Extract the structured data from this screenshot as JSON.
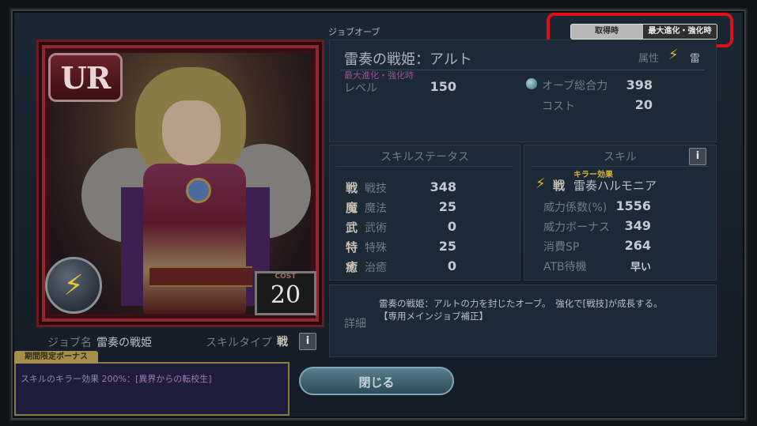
{
  "header": {
    "title": "ジョブオーブ"
  },
  "view_toggle": {
    "option_obtained": "取得時",
    "option_max": "最大進化・強化時",
    "selected": "最大進化・強化時"
  },
  "card": {
    "rarity": "UR",
    "element_icon": "lightning-icon",
    "cost_label": "COST",
    "cost_value": "20",
    "job_label": "ジョブ名",
    "job_name": "雷奏の戦姫",
    "skill_type_label": "スキルタイプ",
    "skill_type_value": "戦"
  },
  "orb": {
    "name": "雷奏の戦姫：アルト",
    "attribute_label": "属性",
    "attribute_value": "雷",
    "max_label": "最大進化・強化時",
    "level_label": "レベル",
    "level_value": "150",
    "power_label": "オーブ総合力",
    "power_value": "398",
    "cost_label": "コスト",
    "cost_value": "20"
  },
  "skill_status": {
    "title": "スキルステータス",
    "rows": [
      {
        "icon": "戦",
        "name": "戦技",
        "value": "348"
      },
      {
        "icon": "魔",
        "name": "魔法",
        "value": "25"
      },
      {
        "icon": "武",
        "name": "武術",
        "value": "0"
      },
      {
        "icon": "特",
        "name": "特殊",
        "value": "25"
      },
      {
        "icon": "癒",
        "name": "治癒",
        "value": "0"
      }
    ]
  },
  "skill": {
    "title": "スキル",
    "killer_label": "キラー効果",
    "type_icon": "戦",
    "name": "雷奏ハルモニア",
    "rows": [
      {
        "name": "威力係数(%)",
        "value": "1556"
      },
      {
        "name": "威力ボーナス",
        "value": "349"
      },
      {
        "name": "消費SP",
        "value": "264"
      },
      {
        "name": "ATB待機",
        "value": "早い"
      }
    ]
  },
  "detail": {
    "label": "詳細",
    "line1": "雷奏の戦姫：アルトの力を封じたオーブ。　強化で[戦技]が成長する。",
    "line2": "【専用メインジョブ補正】"
  },
  "bonus": {
    "tab_label": "期間限定ボーナス",
    "text_prefix": "スキルのキラー効果",
    "text_value": "200%：[異界からの転校生]"
  },
  "close_button": {
    "label": "閉じる"
  },
  "colors": {
    "highlight": "#e0101a",
    "killer": "#d6b43c",
    "max_label": "#a04e8f"
  }
}
